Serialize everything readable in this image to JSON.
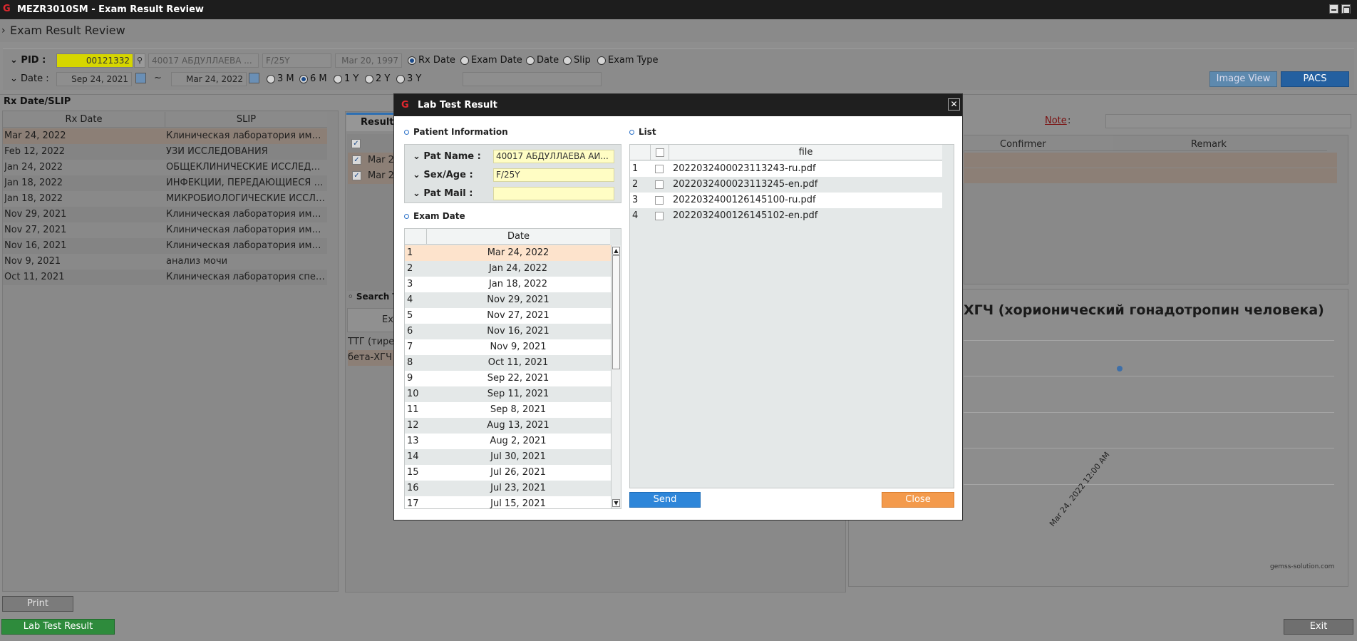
{
  "window": {
    "title": "MEZR3010SM - Exam Result Review",
    "logo": "G"
  },
  "page": {
    "title": "Exam Result Review"
  },
  "filter": {
    "pid_label": "PID :",
    "pid_value": "00121332",
    "patient_name": "40017  АБДУЛЛАЕВА ...",
    "sex_age": "F/25Y",
    "birth_date": "Mar 20, 1997",
    "search_modes": [
      "Rx Date",
      "Exam Date",
      "Date",
      "Slip",
      "Exam Type"
    ],
    "search_mode_selected": "Rx Date",
    "date_label": "Date :",
    "date_from": "Sep 24, 2021",
    "date_sep": "~",
    "date_to": "Mar 24, 2022",
    "periods": [
      "3 M",
      "6 M",
      "1 Y",
      "2 Y",
      "3 Y"
    ],
    "period_selected": "6 M",
    "image_view": "Image View",
    "pacs": "PACS"
  },
  "rx_panel": {
    "title": "Rx Date/SLIP",
    "col_date": "Rx Date",
    "col_slip": "SLIP",
    "rows": [
      {
        "date": "Mar 24, 2022",
        "slip": "Клиническая лаборатория иммун..."
      },
      {
        "date": "Feb 12, 2022",
        "slip": "УЗИ ИССЛЕДОВАНИЯ"
      },
      {
        "date": "Jan 24, 2022",
        "slip": "ОБЩЕКЛИНИЧЕСКИЕ ИССЛЕДОВА..."
      },
      {
        "date": "Jan 18, 2022",
        "slip": "ИНФЕКЦИИ, ПЕРЕДАЮЩИЕСЯ ПО..."
      },
      {
        "date": "Jan 18, 2022",
        "slip": "МИКРОБИОЛОГИЧЕСКИЕ ИССЛЕД..."
      },
      {
        "date": "Nov 29, 2021",
        "slip": "Клиническая лаборатория иммун..."
      },
      {
        "date": "Nov 27, 2021",
        "slip": "Клиническая лаборатория иммун..."
      },
      {
        "date": "Nov 16, 2021",
        "slip": "Клиническая лаборатория иммун..."
      },
      {
        "date": "Nov 9, 2021",
        "slip": "анализ мочи"
      },
      {
        "date": "Oct 11, 2021",
        "slip": "Клиническая лаборатория специа..."
      }
    ]
  },
  "result_panel": {
    "tab": "Result",
    "rows": [
      "Mar 2",
      "Mar 2"
    ],
    "search_title": "Search T",
    "search_col": "Ex",
    "search_rows": [
      "ТТГ (тирес",
      "бета-ХГЧ"
    ]
  },
  "right_panel": {
    "note_label": "Note",
    "note_colon": ":",
    "col_confirmer": "Confirmer",
    "col_remark": "Remark",
    "chart_title": "ХГЧ (хорионический гонадотропин человека)",
    "chart_x_label": "Mar 24, 2022 12:00 AM",
    "watermark": "gemss-solution.com"
  },
  "modal": {
    "title": "Lab Test Result",
    "patient_section": "Patient Information",
    "pat_name_label": "Pat Name :",
    "pat_name": "40017  АБДУЛЛАЕВА АИ...",
    "sex_age_label": "Sex/Age :",
    "sex_age": "F/25Y",
    "pat_mail_label": "Pat Mail :",
    "pat_mail": "",
    "exam_date_section": "Exam Date",
    "date_col": "Date",
    "dates": [
      {
        "n": "1",
        "d": "Mar 24, 2022"
      },
      {
        "n": "2",
        "d": "Jan 24, 2022"
      },
      {
        "n": "3",
        "d": "Jan 18, 2022"
      },
      {
        "n": "4",
        "d": "Nov 29, 2021"
      },
      {
        "n": "5",
        "d": "Nov 27, 2021"
      },
      {
        "n": "6",
        "d": "Nov 16, 2021"
      },
      {
        "n": "7",
        "d": "Nov 9, 2021"
      },
      {
        "n": "8",
        "d": "Oct 11, 2021"
      },
      {
        "n": "9",
        "d": "Sep 22, 2021"
      },
      {
        "n": "10",
        "d": "Sep 11, 2021"
      },
      {
        "n": "11",
        "d": "Sep 8, 2021"
      },
      {
        "n": "12",
        "d": "Aug 13, 2021"
      },
      {
        "n": "13",
        "d": "Aug 2, 2021"
      },
      {
        "n": "14",
        "d": "Jul 30, 2021"
      },
      {
        "n": "15",
        "d": "Jul 26, 2021"
      },
      {
        "n": "16",
        "d": "Jul 23, 2021"
      },
      {
        "n": "17",
        "d": "Jul 15, 2021"
      }
    ],
    "list_section": "List",
    "file_col": "file",
    "files": [
      {
        "n": "1",
        "f": "2022032400023113243-ru.pdf"
      },
      {
        "n": "2",
        "f": "2022032400023113245-en.pdf"
      },
      {
        "n": "3",
        "f": "2022032400126145100-ru.pdf"
      },
      {
        "n": "4",
        "f": "2022032400126145102-en.pdf"
      }
    ],
    "send": "Send",
    "close": "Close"
  },
  "footer": {
    "print": "Print",
    "lab_test_result": "Lab Test Result",
    "exit": "Exit"
  },
  "colors": {
    "accent_blue": "#2e86d9",
    "close_orange": "#f39a4c",
    "pid_yellow": "#d6d600",
    "lab_green": "#2e8b3c",
    "note_red": "#b02020"
  }
}
